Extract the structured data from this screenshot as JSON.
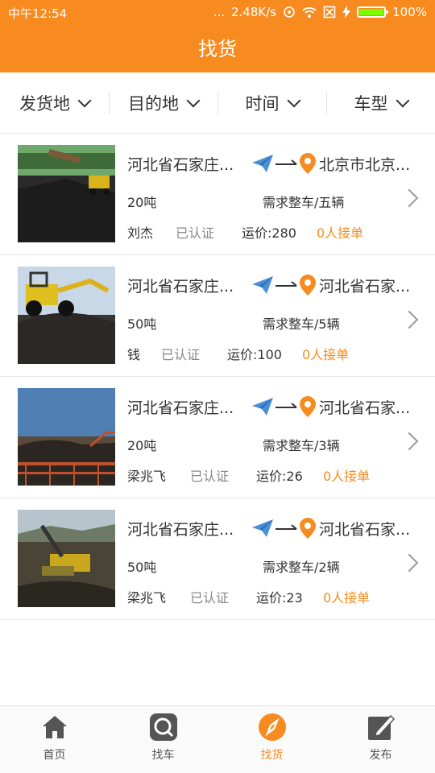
{
  "status_bar": {
    "time": "中午12:54",
    "dots": "...",
    "speed": "2.48K/s",
    "battery": "100%"
  },
  "header": {
    "title": "找货"
  },
  "filters": [
    {
      "label": "发货地"
    },
    {
      "label": "目的地"
    },
    {
      "label": "时间"
    },
    {
      "label": "车型"
    }
  ],
  "items": [
    {
      "from": "河北省石家庄...",
      "to": "北京市北京...",
      "weight": "20吨",
      "need": "需求整车/五辆",
      "name": "刘杰",
      "verified": "已认证",
      "price": "运价:280",
      "accept": "0人接单"
    },
    {
      "from": "河北省石家庄...",
      "to": "河北省石家...",
      "weight": "50吨",
      "need": "需求整车/5辆",
      "name": "钱",
      "verified": "已认证",
      "price": "运价:100",
      "accept": "0人接单"
    },
    {
      "from": "河北省石家庄...",
      "to": "河北省石家...",
      "weight": "20吨",
      "need": "需求整车/3辆",
      "name": "梁兆飞",
      "verified": "已认证",
      "price": "运价:26",
      "accept": "0人接单"
    },
    {
      "from": "河北省石家庄...",
      "to": "河北省石家...",
      "weight": "50吨",
      "need": "需求整车/2辆",
      "name": "梁兆飞",
      "verified": "已认证",
      "price": "运价:23",
      "accept": "0人接单"
    }
  ],
  "tabs": [
    {
      "label": "首页",
      "icon": "home-icon"
    },
    {
      "label": "找车",
      "icon": "search-icon"
    },
    {
      "label": "找货",
      "icon": "compass-icon",
      "active": true
    },
    {
      "label": "发布",
      "icon": "edit-icon"
    }
  ],
  "colors": {
    "accent": "#f78b1f",
    "plane": "#4a90d9",
    "pin": "#f78b1f"
  }
}
